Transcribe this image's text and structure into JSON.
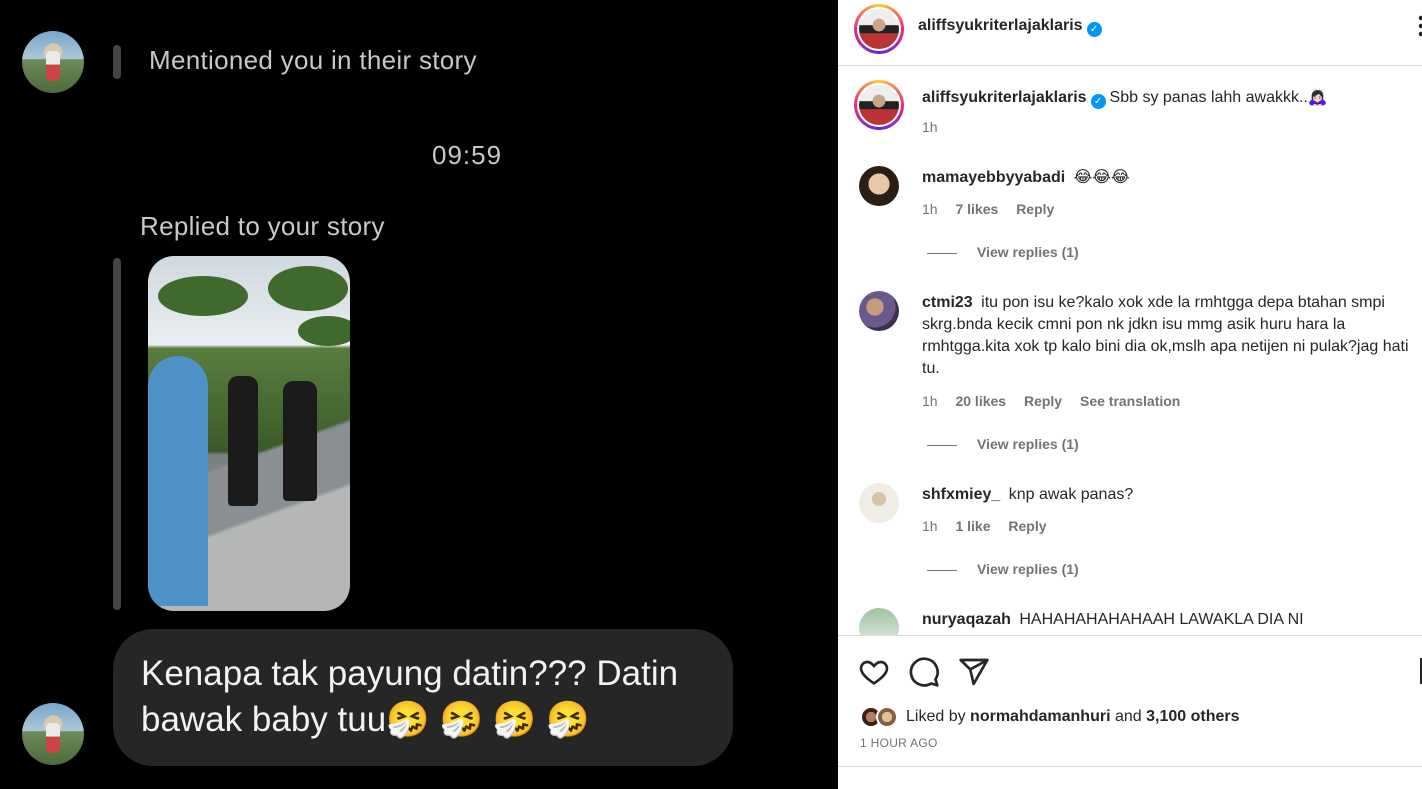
{
  "dm": {
    "mention_text": "Mentioned you in their story",
    "timestamp": "09:59",
    "reply_label": "Replied to your story",
    "message": "Kenapa tak payung datin??? Datin bawak baby tuu🤧 🤧 🤧 🤧"
  },
  "post": {
    "author": "aliffsyukriterlajaklaris",
    "caption": "Sbb sy panas lahh awakkk..🙇🏻‍♀️",
    "caption_time": "1h",
    "comments": [
      {
        "user": "mamayebbyyabadi",
        "text": "😂😂😂",
        "time": "1h",
        "likes": "7 likes",
        "reply": "Reply",
        "view_replies": "View replies (1)"
      },
      {
        "user": "ctmi23",
        "text": "itu pon isu ke?kalo xok xde la rmhtgga depa btahan smpi skrg.bnda kecik cmni pon nk jdkn isu mmg asik huru hara la rmhtgga.kita xok tp kalo bini dia ok,mslh apa netijen ni pulak?jag hati tu.",
        "time": "1h",
        "likes": "20 likes",
        "reply": "Reply",
        "translate": "See translation",
        "view_replies": "View replies (1)"
      },
      {
        "user": "shfxmiey_",
        "text": "knp awak panas?",
        "time": "1h",
        "likes": "1 like",
        "reply": "Reply",
        "view_replies": "View replies (1)"
      },
      {
        "user": "nuryaqazah",
        "text": "HAHAHAHAHAHAAH LAWAKLA DIA NI"
      }
    ],
    "liked_prefix": "Liked by",
    "liked_user": "normahdamanhuri",
    "liked_and": "and",
    "liked_others": "3,100 others",
    "time_ago": "1 HOUR AGO",
    "icons": [
      "heart-icon",
      "comment-icon",
      "share-icon",
      "bookmark-icon"
    ],
    "verified_color": "#0095f6"
  }
}
